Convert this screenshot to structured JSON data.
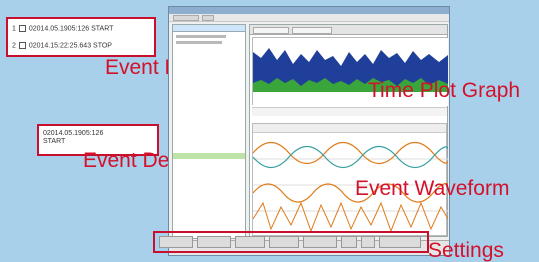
{
  "event_list": {
    "rows": [
      {
        "index": "1",
        "text": "02014.05.1905:126 START"
      },
      {
        "index": "2",
        "text": "02014.15:22:25.643 STOP"
      }
    ],
    "label": "Event List"
  },
  "event_details": {
    "line1": "02014.05.1905:126",
    "line2": "START",
    "label": "Event Details"
  },
  "callouts": {
    "time_plot": "Time Plot Graph",
    "event_waveform": "Event Waveform",
    "settings": "Settings"
  },
  "colors": {
    "callout_red": "#d4112b",
    "background": "#a9d0ea",
    "plot_blue": "#1f3f9a",
    "plot_green": "#3aa53a",
    "wave_orange": "#e07b1a",
    "wave_teal": "#3aa0a0"
  }
}
